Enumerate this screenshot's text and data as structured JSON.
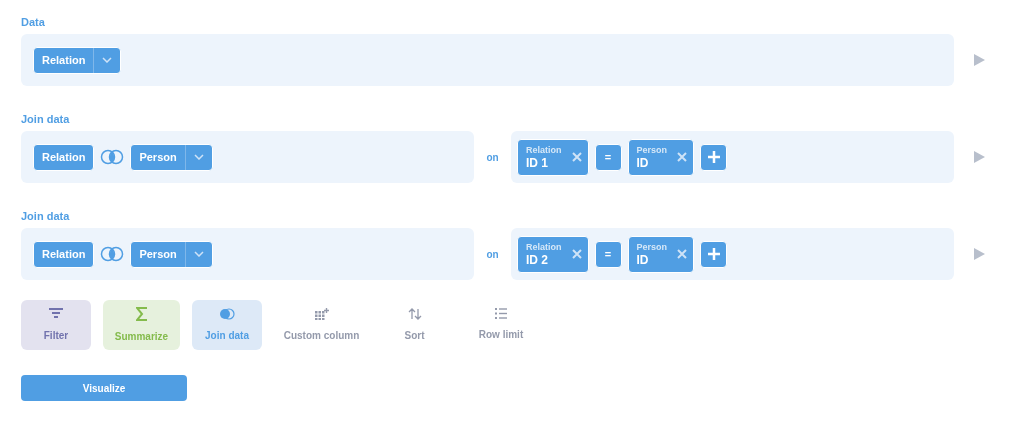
{
  "steps": [
    {
      "kind": "data",
      "label": "Data",
      "table": "Relation"
    },
    {
      "kind": "join",
      "label": "Join data",
      "left_table": "Relation",
      "right_table": "Person",
      "on": "on",
      "conditions": [
        {
          "left": {
            "table": "Relation",
            "column": "ID 1"
          },
          "operator": "=",
          "right": {
            "table": "Person",
            "column": "ID"
          }
        }
      ]
    },
    {
      "kind": "join",
      "label": "Join data",
      "left_table": "Relation",
      "right_table": "Person",
      "on": "on",
      "conditions": [
        {
          "left": {
            "table": "Relation",
            "column": "ID 2"
          },
          "operator": "=",
          "right": {
            "table": "Person",
            "column": "ID"
          }
        }
      ]
    }
  ],
  "actions": [
    {
      "kind": "filter",
      "label": "Filter"
    },
    {
      "kind": "summarize",
      "label": "Summarize"
    },
    {
      "kind": "join",
      "label": "Join data"
    },
    {
      "kind": "custom_column",
      "label": "Custom column"
    },
    {
      "kind": "sort",
      "label": "Sort"
    },
    {
      "kind": "limit",
      "label": "Row limit"
    }
  ],
  "visualize": "Visualize"
}
